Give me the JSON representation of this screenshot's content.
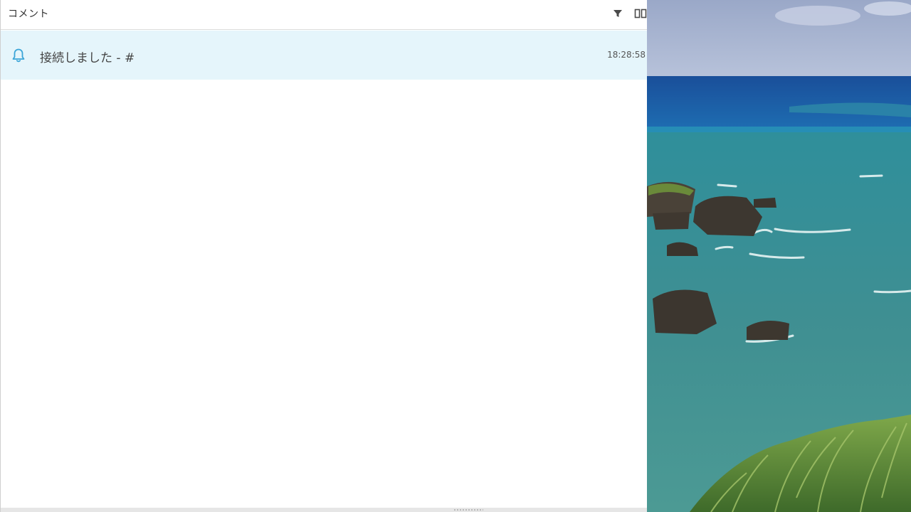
{
  "panel": {
    "title": "コメント",
    "header_icons": [
      "filter-icon",
      "columns-icon"
    ]
  },
  "comments": [
    {
      "icon": "bell-icon",
      "text": "接続しました - #",
      "time": "18:28:58"
    }
  ],
  "colors": {
    "row_highlight": "#e5f5fb",
    "accent": "#3ba5d8"
  },
  "scene": {
    "description_icon": "ocean-coast-photo"
  }
}
